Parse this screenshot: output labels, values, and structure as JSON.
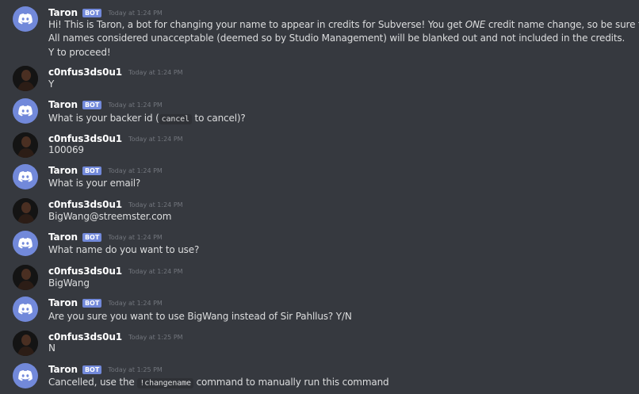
{
  "messages": [
    {
      "author": "Taron",
      "bot_badge": "BOT",
      "time": "Today at 1:24 PM",
      "line1_a": "Hi! This is Taron, a bot for changing your name to appear in credits for Subverse! You get ",
      "line1_em": "ONE",
      "line1_b": " credit name change, so be sure to pick wisely!",
      "line2": "All names considered unacceptable (deemed so by Studio Management) will be blanked out and not included in the credits.",
      "line3": "Y to proceed!"
    },
    {
      "author": "c0nfus3ds0u1",
      "time": "Today at 1:24 PM",
      "text": "Y"
    },
    {
      "author": "Taron",
      "bot_badge": "BOT",
      "time": "Today at 1:24 PM",
      "text_a": "What is your backer id (",
      "code": "cancel",
      "text_b": " to cancel)?"
    },
    {
      "author": "c0nfus3ds0u1",
      "time": "Today at 1:24 PM",
      "text": "100069"
    },
    {
      "author": "Taron",
      "bot_badge": "BOT",
      "time": "Today at 1:24 PM",
      "text": "What is your email?"
    },
    {
      "author": "c0nfus3ds0u1",
      "time": "Today at 1:24 PM",
      "text": "BigWang@streemster.com"
    },
    {
      "author": "Taron",
      "bot_badge": "BOT",
      "time": "Today at 1:24 PM",
      "text": "What name do you want to use?"
    },
    {
      "author": "c0nfus3ds0u1",
      "time": "Today at 1:24 PM",
      "text": "BigWang"
    },
    {
      "author": "Taron",
      "bot_badge": "BOT",
      "time": "Today at 1:24 PM",
      "text": "Are you sure you want to use BigWang instead of Sir Pahllus? Y/N"
    },
    {
      "author": "c0nfus3ds0u1",
      "time": "Today at 1:25 PM",
      "text": "N"
    },
    {
      "author": "Taron",
      "bot_badge": "BOT",
      "time": "Today at 1:25 PM",
      "text_a": "Cancelled, use the ",
      "code": "!changename",
      "text_b": " command to manually run this command"
    }
  ],
  "colors": {
    "background": "#36393f",
    "bot_avatar": "#7289da",
    "badge": "#7289da",
    "timestamp": "#72767d",
    "username": "#ffffff",
    "text": "#dcddde"
  }
}
